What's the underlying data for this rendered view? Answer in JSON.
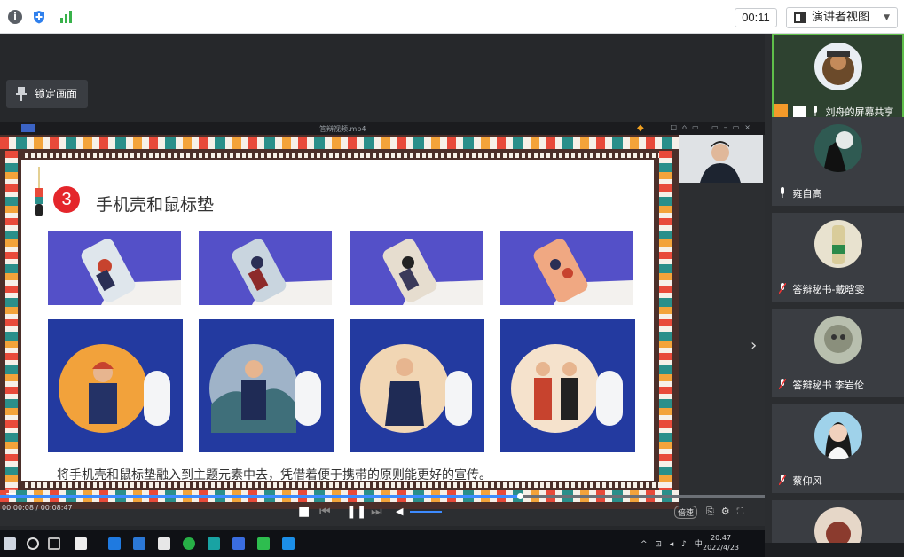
{
  "topbar": {
    "timer": "00:11",
    "view_label": "演讲者视图",
    "icons": [
      "info-icon",
      "shield-icon",
      "signal-icon"
    ]
  },
  "stage": {
    "lock_label": "锁定画面"
  },
  "player": {
    "file_name": "答辩视频.mp4",
    "timecode": "00:00:08 / 00:08:47",
    "progress": 0.68,
    "speed_label": "倍速"
  },
  "slide": {
    "number": "3",
    "title": "手机壳和鼠标垫",
    "caption": "将手机壳和鼠标垫融入到主题元素中去，凭借着便于携带的原则能更好的宣传。"
  },
  "taskbar": {
    "clock_time": "20:47",
    "clock_date": "2022/4/23"
  },
  "participants": [
    {
      "name": "刘舟的屏幕共享",
      "active": true
    },
    {
      "name": "雍自高",
      "active": false
    },
    {
      "name": "答辩秘书-戴晗雯",
      "active": false
    },
    {
      "name": "答辩秘书 李岩伦",
      "active": false
    },
    {
      "name": "蔡仰风",
      "active": false
    }
  ],
  "colors": {
    "accent": "#3d8bff",
    "active_border": "#5fbf4a",
    "slide_red": "#e4262b",
    "card_purple": "#5450c8",
    "card_navy": "#233aa0"
  }
}
